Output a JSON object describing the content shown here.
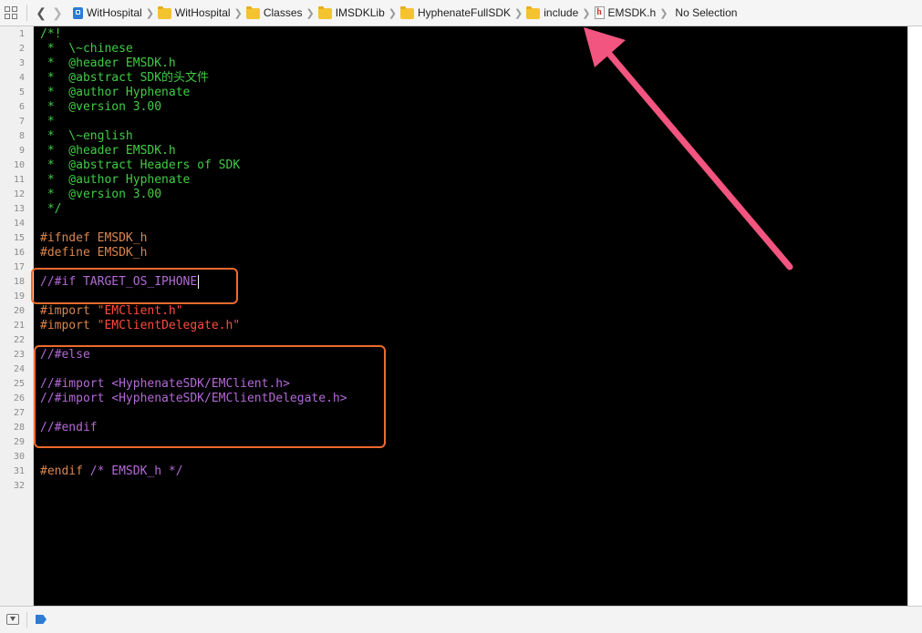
{
  "jumpbar": {
    "crumbs": [
      {
        "label": "WitHospital",
        "icon": "project-icon"
      },
      {
        "label": "WitHospital",
        "icon": "folder-icon"
      },
      {
        "label": "Classes",
        "icon": "folder-icon"
      },
      {
        "label": "IMSDKLib",
        "icon": "folder-icon"
      },
      {
        "label": "HyphenateFullSDK",
        "icon": "folder-icon"
      },
      {
        "label": "include",
        "icon": "folder-icon"
      },
      {
        "label": "EMSDK.h",
        "icon": "header-file-icon",
        "icon_glyph": "h"
      },
      {
        "label": "No Selection"
      }
    ]
  },
  "colors": {
    "comment": "#41cc45",
    "preprocessor": "#d98650",
    "string": "#ff4a3d",
    "commented_directive": "#b36ad7",
    "annotation_box": "#ee6b2d",
    "annotation_arrow": "#f2557f",
    "breakpoint": "#2e7bd6"
  },
  "editor": {
    "line_count": 32,
    "lines": [
      [
        {
          "t": "/*!",
          "c": "comment"
        }
      ],
      [
        {
          "t": " *  \\~chinese",
          "c": "comment"
        }
      ],
      [
        {
          "t": " *  @header EMSDK.h",
          "c": "comment"
        }
      ],
      [
        {
          "t": " *  @abstract SDK的头文件",
          "c": "comment"
        }
      ],
      [
        {
          "t": " *  @author Hyphenate",
          "c": "comment"
        }
      ],
      [
        {
          "t": " *  @version 3.00",
          "c": "comment"
        }
      ],
      [
        {
          "t": " *",
          "c": "comment"
        }
      ],
      [
        {
          "t": " *  \\~english",
          "c": "comment"
        }
      ],
      [
        {
          "t": " *  @header EMSDK.h",
          "c": "comment"
        }
      ],
      [
        {
          "t": " *  @abstract Headers of SDK",
          "c": "comment"
        }
      ],
      [
        {
          "t": " *  @author Hyphenate",
          "c": "comment"
        }
      ],
      [
        {
          "t": " *  @version 3.00",
          "c": "comment"
        }
      ],
      [
        {
          "t": " */",
          "c": "comment"
        }
      ],
      [],
      [
        {
          "t": "#ifndef EMSDK_h",
          "c": "pre"
        }
      ],
      [
        {
          "t": "#define EMSDK_h",
          "c": "pre"
        }
      ],
      [],
      [
        {
          "t": "//#if TARGET_OS_IPHONE",
          "c": "ghost"
        }
      ],
      [],
      [
        {
          "t": "#import ",
          "c": "pre"
        },
        {
          "t": "\"EMClient.h\"",
          "c": "str"
        }
      ],
      [
        {
          "t": "#import ",
          "c": "pre"
        },
        {
          "t": "\"EMClientDelegate.h\"",
          "c": "str"
        }
      ],
      [],
      [
        {
          "t": "//#else",
          "c": "ghost"
        }
      ],
      [],
      [
        {
          "t": "//#import <HyphenateSDK/EMClient.h>",
          "c": "ghost"
        }
      ],
      [
        {
          "t": "//#import <HyphenateSDK/EMClientDelegate.h>",
          "c": "ghost"
        }
      ],
      [],
      [
        {
          "t": "//#endif",
          "c": "ghost"
        }
      ],
      [],
      [],
      [
        {
          "t": "#endif ",
          "c": "pre"
        },
        {
          "t": "/* EMSDK_h */",
          "c": "ghost"
        }
      ],
      []
    ],
    "cursor_line": 18
  },
  "statusbar": {
    "debug_area_toggle_icon": "debug-area-toggle-icon",
    "breakpoint_icon": "breakpoint-icon"
  }
}
